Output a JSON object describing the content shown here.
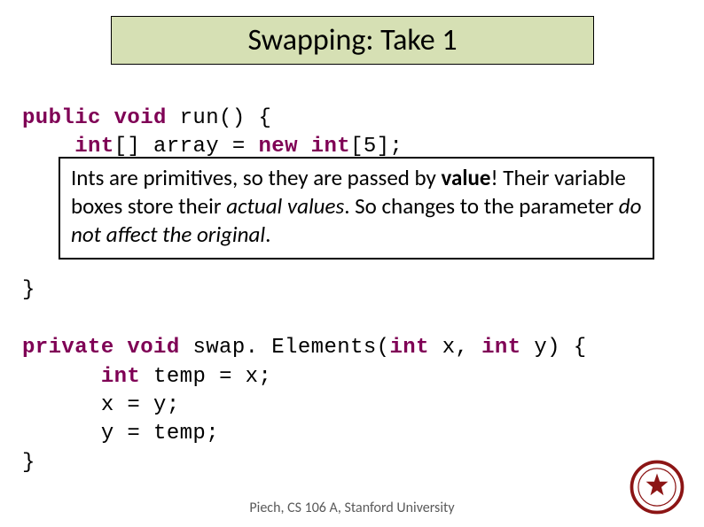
{
  "title": "Swapping: Take 1",
  "code": {
    "method1_sig_pre": "public void",
    "method1_name": " run() {",
    "line2_pre": "    ",
    "line2_kw1": "int",
    "line2_mid": "[] array = ",
    "line2_kw2": "new int",
    "line2_end": "[5];",
    "close1": "}",
    "method2_sig_pre": "private void",
    "method2_name": " swap. Elements(",
    "method2_kw1": "int",
    "method2_mid1": " x, ",
    "method2_kw2": "int",
    "method2_mid2": " y) {",
    "line_a_pre": "      ",
    "line_a_kw": "int",
    "line_a_rest": " temp = x;",
    "line_b": "      x = y;",
    "line_c": "      y = temp;",
    "close2": "}"
  },
  "overlay": {
    "p1_a": "Ints are primitives, so they are passed by ",
    "p1_b": "value",
    "p1_c": "!  Their variable boxes store their ",
    "p1_d": "actual values",
    "p1_e": ".  So changes to the parameter ",
    "p1_f": "do not affect the original",
    "p1_g": "."
  },
  "footer": "Piech, CS 106 A, Stanford University",
  "seal_alt": "Stanford University seal"
}
